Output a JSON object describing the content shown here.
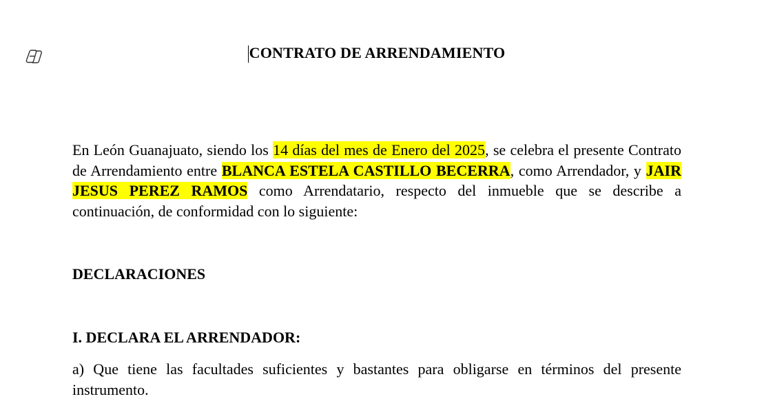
{
  "document": {
    "title": "CONTRATO DE ARRENDAMIENTO",
    "intro": {
      "t1": "En León Guanajuato, siendo los ",
      "date": "14 días del mes de Enero del 2025",
      "t2": ", se celebra el presente Contrato de Arrendamiento entre ",
      "lessor": "BLANCA ESTELA CASTILLO BECERRA",
      "t3": ", como Arrendador, y ",
      "lessee": "JAIR JESUS PEREZ RAMOS",
      "t4": " como Arrendatario, respecto del inmueble que se describe a continuación, de conformidad con lo siguiente:"
    },
    "section_heading": "DECLARACIONES",
    "subsection_heading": "I. DECLARA EL ARRENDADOR:",
    "clause_a": "a) Que tiene las facultades suficientes y bastantes para obligarse en términos del presente instrumento."
  },
  "colors": {
    "highlight": "#ffff00",
    "text": "#000000"
  },
  "icons": {
    "copilot": "copilot-icon"
  }
}
